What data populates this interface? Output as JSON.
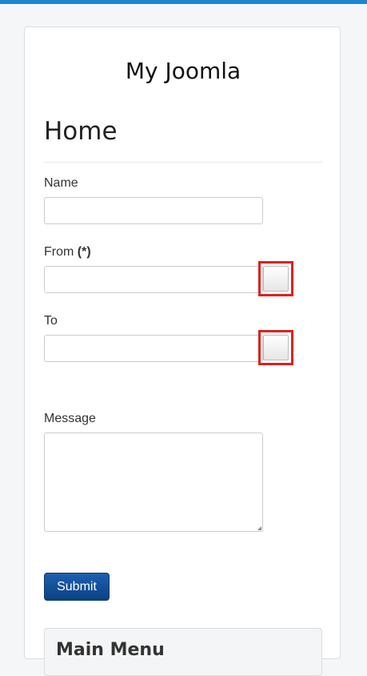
{
  "site": {
    "title": "My Joomla"
  },
  "page": {
    "title": "Home"
  },
  "form": {
    "name_label": "Name",
    "from_label": "From",
    "from_required": "(*)",
    "to_label": "To",
    "message_label": "Message",
    "submit_label": "Submit"
  },
  "module": {
    "title": "Main Menu"
  },
  "colors": {
    "accent": "#1a86d0",
    "submit": "#0b4283",
    "highlight": "#e02020"
  }
}
